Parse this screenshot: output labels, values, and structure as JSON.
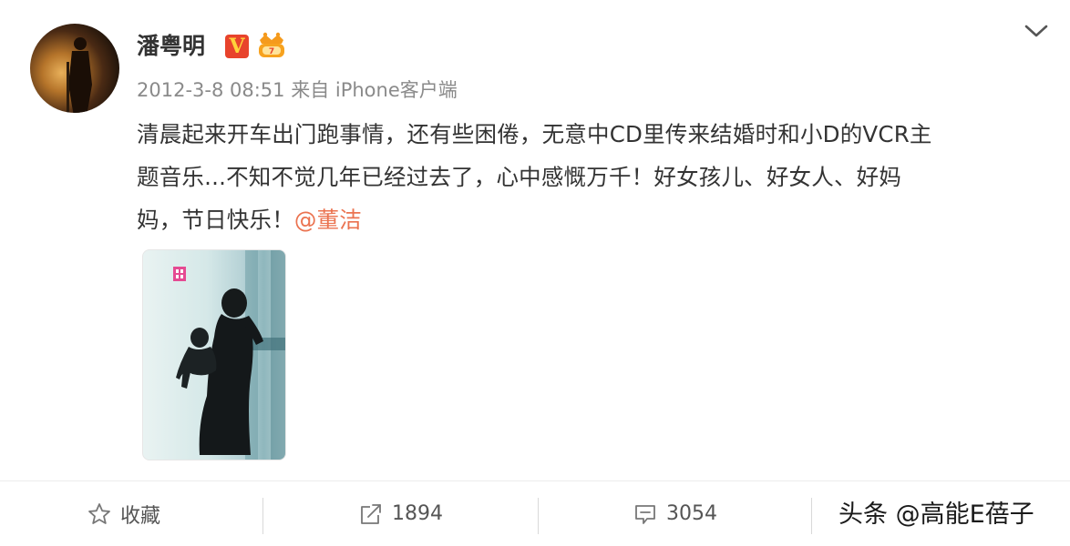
{
  "post": {
    "author": "潘粤明",
    "timestamp": "2012-3-8 08:51",
    "source": "来自 iPhone客户端",
    "content_lines": [
      "清晨起来开车出门跑事情，还有些困倦，无意中CD里传来结婚时和小D的VCR主",
      "题音乐...不知不觉几年已经过去了，心中感慨万千！好女孩儿、好女人、好妈",
      "妈，节日快乐！"
    ],
    "mention": "@董洁",
    "vip_badge": "V"
  },
  "actions": {
    "favorite_label": "收藏",
    "repost_count": "1894",
    "comment_count": "3054"
  },
  "watermark": "头条 @高能E蓓子",
  "colors": {
    "mention": "#eb7350",
    "vip_badge": "#e8432c",
    "meta_text": "#8a8a8a"
  },
  "icons": {
    "favorite": "star-outline-icon",
    "repost": "share-arrow-icon",
    "comment": "comment-bubble-icon",
    "dropdown": "chevron-down-icon"
  }
}
